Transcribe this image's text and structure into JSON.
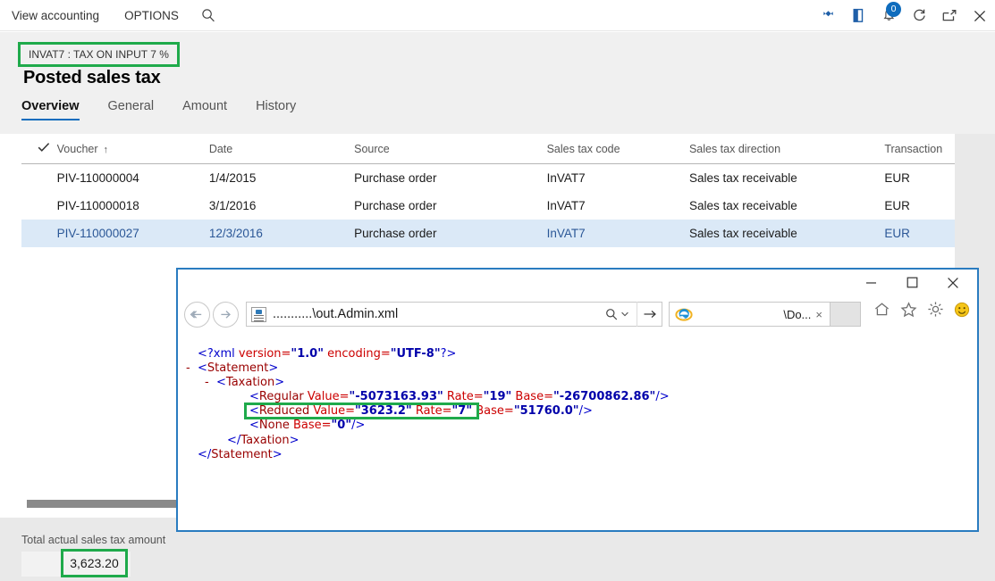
{
  "commandbar": {
    "items": [
      {
        "label": "View accounting",
        "name": "view-accounting-button"
      },
      {
        "label": "OPTIONS",
        "name": "options-button"
      }
    ],
    "search_icon": "search-icon",
    "right_icons": [
      {
        "name": "company-switch-icon",
        "glyph": "❖"
      },
      {
        "name": "office-app-icon",
        "glyph": "◗"
      },
      {
        "name": "notifications-icon",
        "glyph": "⚑",
        "badge": "0"
      },
      {
        "name": "refresh-icon",
        "glyph": "↻"
      },
      {
        "name": "open-in-new-window-icon",
        "glyph": "↗"
      },
      {
        "name": "close-icon",
        "glyph": "✕"
      }
    ]
  },
  "page": {
    "caption": "INVAT7 : TAX ON INPUT 7 %",
    "title": "Posted sales tax"
  },
  "tabs": [
    {
      "label": "Overview",
      "active": true
    },
    {
      "label": "General",
      "active": false
    },
    {
      "label": "Amount",
      "active": false
    },
    {
      "label": "History",
      "active": false
    }
  ],
  "grid": {
    "columns": [
      {
        "key": "check",
        "label": "✓"
      },
      {
        "key": "voucher",
        "label": "Voucher",
        "sort": "↑"
      },
      {
        "key": "date",
        "label": "Date"
      },
      {
        "key": "source",
        "label": "Source"
      },
      {
        "key": "code",
        "label": "Sales tax code"
      },
      {
        "key": "direction",
        "label": "Sales tax direction"
      },
      {
        "key": "transaction",
        "label": "Transaction"
      }
    ],
    "rows": [
      {
        "voucher": "PIV-110000004",
        "date": "1/4/2015",
        "source": "Purchase order",
        "code": "InVAT7",
        "direction": "Sales tax receivable",
        "transaction": "EUR",
        "selected": false
      },
      {
        "voucher": "PIV-110000018",
        "date": "3/1/2016",
        "source": "Purchase order",
        "code": "InVAT7",
        "direction": "Sales tax receivable",
        "transaction": "EUR",
        "selected": false
      },
      {
        "voucher": "PIV-110000027",
        "date": "12/3/2016",
        "source": "Purchase order",
        "code": "InVAT7",
        "direction": "Sales tax receivable",
        "transaction": "EUR",
        "selected": true
      }
    ]
  },
  "footer": {
    "total_label": "Total actual sales tax amount",
    "total_value": "3,623.20"
  },
  "browser": {
    "address": "...........\\out.Admin.xml",
    "tab_title": "\\Do...",
    "tab_close": "×",
    "search_glyph": "🔍",
    "search_caret": "▾",
    "go_glyph": "→",
    "back_glyph": "←",
    "forward_glyph": "→",
    "window_buttons": {
      "minimize": "—",
      "maximize": "□",
      "close": "✕"
    },
    "tool_icons": [
      {
        "name": "home-icon",
        "glyph": "⌂"
      },
      {
        "name": "favorites-star-icon",
        "glyph": "☆"
      },
      {
        "name": "settings-gear-icon",
        "glyph": "⚙"
      },
      {
        "name": "smiley-feedback-icon",
        "glyph": "☺"
      }
    ]
  },
  "xml": {
    "lines": [
      {
        "indent": 22,
        "collapse": "",
        "parts": [
          {
            "c": "tagb",
            "t": "<?xml "
          },
          {
            "c": "attr",
            "t": "version="
          },
          {
            "c": "val",
            "t": "\"1.0\""
          },
          {
            "c": "attr",
            "t": " encoding="
          },
          {
            "c": "val",
            "t": "\"UTF-8\""
          },
          {
            "c": "tagb",
            "t": "?>"
          }
        ]
      },
      {
        "indent": 22,
        "collapse": "-",
        "parts": [
          {
            "c": "tagb",
            "t": "<"
          },
          {
            "c": "tagr",
            "t": "Statement"
          },
          {
            "c": "tagb",
            "t": ">"
          }
        ]
      },
      {
        "indent": 43,
        "collapse": "-",
        "parts": [
          {
            "c": "tagb",
            "t": "<"
          },
          {
            "c": "tagr",
            "t": "Taxation"
          },
          {
            "c": "tagb",
            "t": ">"
          }
        ]
      },
      {
        "indent": 80,
        "collapse": "",
        "parts": [
          {
            "c": "tagb",
            "t": "<"
          },
          {
            "c": "tagr",
            "t": "Regular "
          },
          {
            "c": "attr",
            "t": "Value="
          },
          {
            "c": "val",
            "t": "\"-5073163.93\""
          },
          {
            "c": "attr",
            "t": " Rate="
          },
          {
            "c": "val",
            "t": "\"19\""
          },
          {
            "c": "attr",
            "t": " Base="
          },
          {
            "c": "val",
            "t": "\"-26700862.86\""
          },
          {
            "c": "tagb",
            "t": "/>"
          }
        ]
      },
      {
        "indent": 80,
        "collapse": "",
        "parts": [
          {
            "c": "tagb",
            "t": "<"
          },
          {
            "c": "tagr",
            "t": "Reduced "
          },
          {
            "c": "attr",
            "t": "Value="
          },
          {
            "c": "val",
            "t": "\"3623.2\""
          },
          {
            "c": "attr",
            "t": " Rate="
          },
          {
            "c": "val",
            "t": "\"7\""
          },
          {
            "c": "attr",
            "t": " Base="
          },
          {
            "c": "val",
            "t": "\"51760.0\""
          },
          {
            "c": "tagb",
            "t": "/>"
          }
        ]
      },
      {
        "indent": 80,
        "collapse": "",
        "parts": [
          {
            "c": "tagb",
            "t": "<"
          },
          {
            "c": "tagr",
            "t": "None "
          },
          {
            "c": "attr",
            "t": "Base="
          },
          {
            "c": "val",
            "t": "\"0\""
          },
          {
            "c": "tagb",
            "t": "/>"
          }
        ]
      },
      {
        "indent": 55,
        "collapse": "",
        "parts": [
          {
            "c": "tagb",
            "t": "</"
          },
          {
            "c": "tagr",
            "t": "Taxation"
          },
          {
            "c": "tagb",
            "t": ">"
          }
        ]
      },
      {
        "indent": 22,
        "collapse": "",
        "parts": [
          {
            "c": "tagb",
            "t": "</"
          },
          {
            "c": "tagr",
            "t": "Statement"
          },
          {
            "c": "tagb",
            "t": ">"
          }
        ]
      }
    ]
  },
  "highlight_color": "#1faa4b"
}
